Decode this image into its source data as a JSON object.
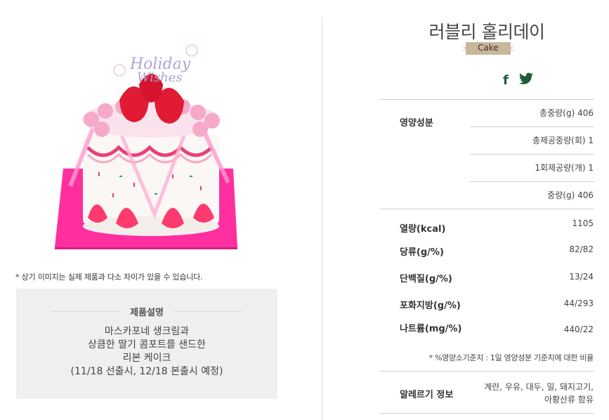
{
  "product": {
    "title": "러블리 홀리데이",
    "category": "Cake",
    "topper_text": [
      "Holiday",
      "Wishes"
    ],
    "disclaimer": "* 상기 이미지는 실제 제품과 다소 차이가 있을 수 있습니다.",
    "description_heading": "제품설명",
    "description_lines": [
      "마스카포네 생크림과",
      "상큼한 딸기 콤포트를 샌드한",
      "리본 케이크",
      "(11/18 선출시, 12/18 본출시 예정)"
    ]
  },
  "share": {
    "facebook_icon": "f",
    "twitter_icon": "twitter-bird"
  },
  "nutrition": {
    "heading": "영양성분",
    "weights": [
      {
        "label": "총중량(g) 406"
      },
      {
        "label": "총제공중량(회) 1"
      },
      {
        "label": "1회제공량(개) 1"
      },
      {
        "label": "중량(g) 406"
      }
    ],
    "rows": [
      {
        "label": "열량(kcal)",
        "value": "1105"
      },
      {
        "label": "당류(g/%)",
        "value": "82/82"
      },
      {
        "label": "단백질(g/%)",
        "value": "13/24"
      },
      {
        "label": "포화지방(g/%)",
        "value": "44/293"
      },
      {
        "label": "나트륨(mg/%)",
        "value": "440/22"
      }
    ],
    "note": "* %영양소기준치 : 1일 영양성분 기준치에 대한 비율"
  },
  "allergy": {
    "label": "알레르기 정보",
    "value": "계란, 우유, 대두, 밀, 돼지고기, 아황산류 함유"
  },
  "colors": {
    "accent_green": "#1d5c3c",
    "ribbon": "#c9b79c",
    "box_bg": "#efefef",
    "cake_pink": "#ff3fa4"
  }
}
